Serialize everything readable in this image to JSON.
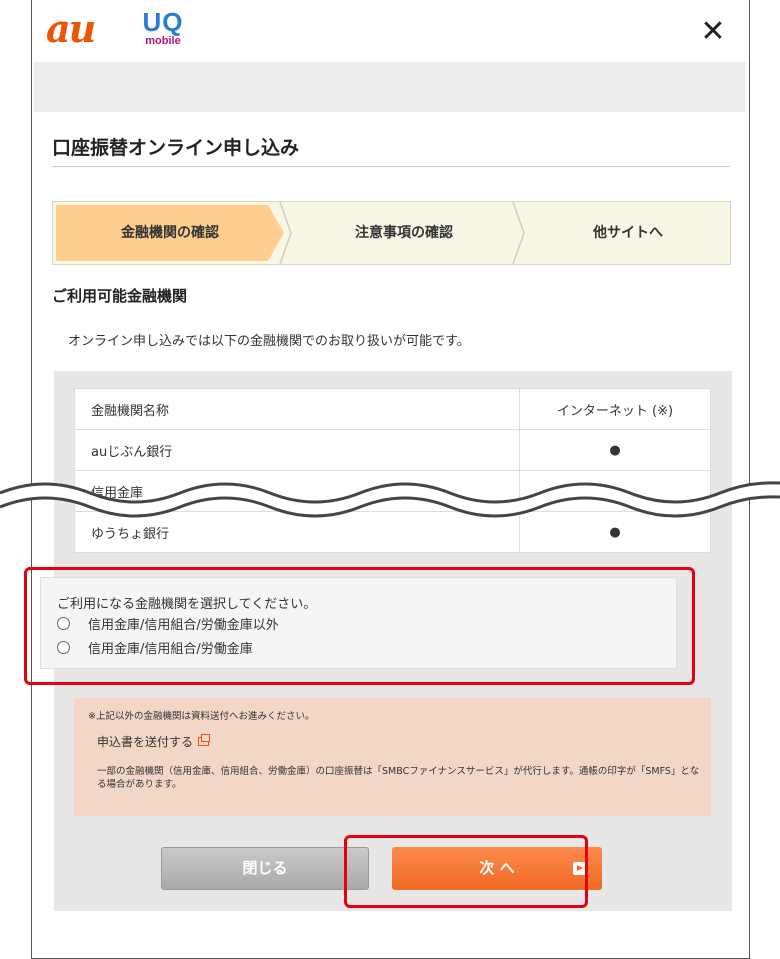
{
  "header": {
    "logo_au": "au",
    "logo_uq": "UQ",
    "logo_uq_sub": "mobile",
    "close": "✕"
  },
  "page_title": "口座振替オンライン申し込み",
  "steps": [
    {
      "label": "金融機関の確認",
      "active": true
    },
    {
      "label": "注意事項の確認",
      "active": false
    },
    {
      "label": "他サイトへ",
      "active": false
    }
  ],
  "section_heading": "ご利用可能金融機関",
  "intro": "オンライン申し込みでは以下の金融機関でのお取り扱いが可能です。",
  "table": {
    "headers": [
      "金融機関名称",
      "インターネット (※)"
    ],
    "rows": [
      [
        "auじぶん銀行",
        "●"
      ],
      [
        "信用金庫",
        ""
      ],
      [
        "ゆうちょ銀行",
        "●"
      ]
    ]
  },
  "select": {
    "label": "ご利用になる金融機関を選択してください。",
    "options": [
      "信用金庫/信用組合/労働金庫以外",
      "信用金庫/信用組合/労働金庫"
    ]
  },
  "notice": {
    "line1": "※上記以外の金融機関は資料送付へお進みください。",
    "link": "申込書を送付する",
    "line3": "一部の金融機関（信用金庫、信用組合、労働金庫）の口座振替は「SMBCファイナンスサービス」が代行します。通帳の印字が「SMFS」となる場合があります。"
  },
  "buttons": {
    "close": "閉じる",
    "next": "次 へ"
  },
  "colors": {
    "accent": "#f06a23",
    "highlight": "#e60012",
    "step_active": "#fecf8e"
  }
}
